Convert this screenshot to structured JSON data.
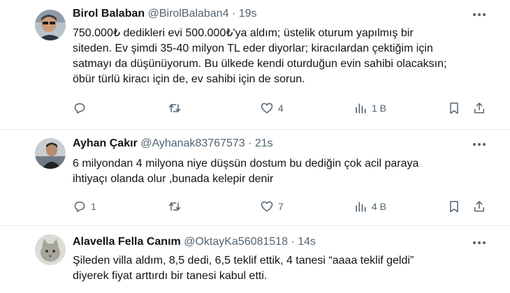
{
  "tweets": [
    {
      "name": "Birol Balaban",
      "handle": "@BirolBalaban4",
      "time": "19s",
      "text_lines": [
        "750.000₺ dedikleri evi 500.000₺'ya aldım; üstelik oturum yapılmış bir",
        "siteden. Ev şimdi 35-40 milyon TL eder diyorlar; kiracılardan çektiğim için",
        "satmayı da düşünüyorum. Bu ülkede kendi oturduğun evin sahibi olacaksın;",
        "öbür türlü kiracı için de, ev sahibi için de sorun."
      ],
      "replies": "",
      "retweets": "",
      "likes": "4",
      "views": "1 B"
    },
    {
      "name": "Ayhan Çakır",
      "handle": "@Ayhanak83767573",
      "time": "21s",
      "text_lines": [
        "6 milyondan 4 milyona niye düşsün dostum bu dediğin çok acil paraya",
        "ihtiyaçı olanda olur ,bunada kelepir denir"
      ],
      "replies": "1",
      "retweets": "",
      "likes": "7",
      "views": "4 B"
    },
    {
      "name": "Alavella Fella Canım",
      "handle": "@OktayKa56081518",
      "time": "14s",
      "text_lines": [
        "Şileden villa aldım, 8,5 dedi, 6,5 teklif ettik, 4 tanesi “aaaa teklif geldi”",
        "diyerek fiyat arttırdı bir tanesi kabul etti."
      ]
    }
  ],
  "separator": "·",
  "icons": {
    "more": "more-horizontal-icon",
    "reply": "reply-icon",
    "retweet": "retweet-icon",
    "like": "heart-icon",
    "views": "views-icon",
    "bookmark": "bookmark-icon",
    "share": "share-icon"
  },
  "colors": {
    "text": "#0f1419",
    "secondary": "#536471",
    "divider": "#e7e9ec"
  }
}
